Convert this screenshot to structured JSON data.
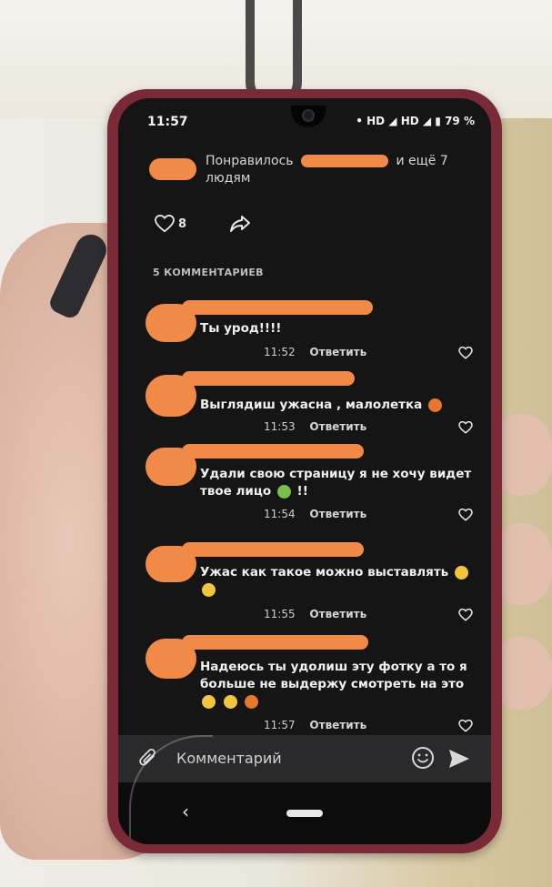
{
  "status_bar": {
    "time": "11:57",
    "indicators": "• HD ◢ HD ◢ ▮ 79 %"
  },
  "likes": {
    "prefix": "Понравилось",
    "suffix": "и ещё 7 людям",
    "count": "8"
  },
  "comments_header": "5 КОММЕНТАРИЕВ",
  "comments": [
    {
      "text": "Ты урод!!!!",
      "time": "11:52",
      "reply": "Ответить"
    },
    {
      "text": "Выглядиш ужасна , малолетка",
      "time": "11:53",
      "reply": "Ответить"
    },
    {
      "text": "Удали свою страницу я не хочу видет твое лицо",
      "text_end": "!!",
      "time": "11:54",
      "reply": "Ответить"
    },
    {
      "text": "Ужас как такое можно выставлять",
      "time": "11:55",
      "reply": "Ответить"
    },
    {
      "text": "Надеюсь ты удолиш эту фотку а то я больше не выдержу смотреть на это",
      "time": "11:57",
      "reply": "Ответить"
    }
  ],
  "input": {
    "placeholder": "Комментарий"
  },
  "icons": {
    "heart": "heart-icon",
    "share": "share-icon",
    "attach": "paperclip-icon",
    "emoji": "smile-icon",
    "send": "send-icon",
    "back": "back-icon",
    "home": "home-icon"
  },
  "colors": {
    "redaction": "#f08a46",
    "phone_case": "#7a2a36",
    "screen_bg": "#151516"
  }
}
